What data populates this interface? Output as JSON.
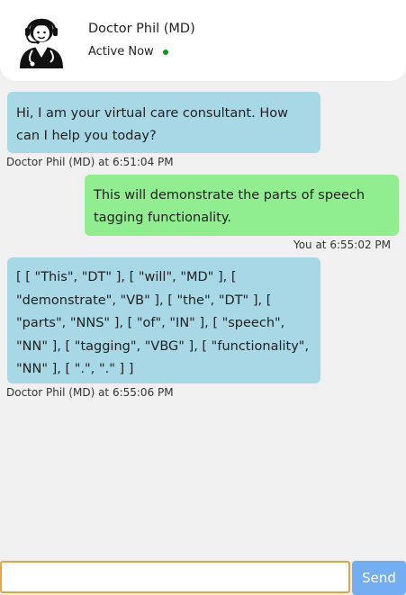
{
  "header": {
    "doctor_name": "Doctor Phil (MD)",
    "status_text": "Active Now",
    "status_color": "#0a9a20"
  },
  "messages": [
    {
      "sender": "bot",
      "text": "Hi, I am your virtual care consultant. How can I help you today?",
      "meta": "Doctor Phil (MD) at 6:51:04 PM"
    },
    {
      "sender": "user",
      "text": "This will demonstrate the parts of speech tagging functionality.",
      "meta": "You at 6:55:02 PM"
    },
    {
      "sender": "bot",
      "text": "[ [ \"This\", \"DT\" ], [ \"will\", \"MD\" ], [ \"demonstrate\", \"VB\" ], [ \"the\", \"DT\" ], [ \"parts\", \"NNS\" ], [ \"of\", \"IN\" ], [ \"speech\", \"NN\" ], [ \"tagging\", \"VBG\" ], [ \"functionality\", \"NN\" ], [ \".\", \".\" ] ]",
      "meta": "Doctor Phil (MD) at 6:55:06 PM"
    }
  ],
  "composer": {
    "input_value": "",
    "send_label": "Send"
  },
  "colors": {
    "bot_bubble": "#a8d8e6",
    "user_bubble": "#90ee90",
    "send_button": "#74aef2",
    "input_border": "#e8a33b"
  }
}
